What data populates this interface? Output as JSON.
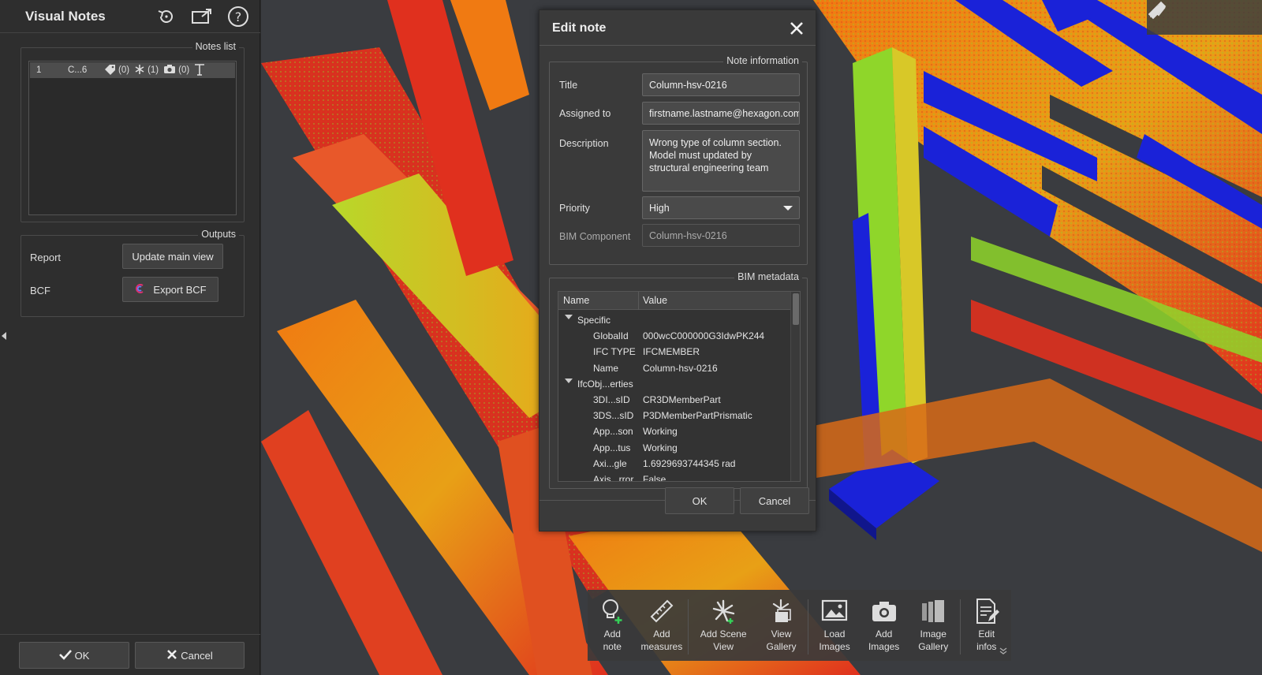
{
  "left_panel": {
    "title": "Visual Notes",
    "notes_list": {
      "group_title": "Notes list",
      "items": [
        {
          "index": "1",
          "name": "C...6",
          "tags": "(0)",
          "views": "(1)",
          "images": "(0)"
        }
      ]
    },
    "outputs": {
      "group_title": "Outputs",
      "report_label": "Report",
      "update_main_view": "Update main view",
      "bcf_label": "BCF",
      "export_bcf": "Export BCF"
    },
    "footer": {
      "ok": "OK",
      "cancel": "Cancel"
    }
  },
  "dialog": {
    "title": "Edit note",
    "note_info": {
      "group_title": "Note information",
      "title_label": "Title",
      "title_value": "Column-hsv-0216",
      "assigned_label": "Assigned to",
      "assigned_value": "firstname.lastname@hexagon.com",
      "description_label": "Description",
      "description_value": "Wrong type of column section. Model must updated by structural engineering team",
      "priority_label": "Priority",
      "priority_value": "High",
      "bim_label": "BIM Component",
      "bim_value": "Column-hsv-0216"
    },
    "bim_metadata": {
      "group_title": "BIM metadata",
      "col_name": "Name",
      "col_value": "Value",
      "rows": [
        {
          "name": "Specific",
          "value": "",
          "group": true
        },
        {
          "name": "GlobalId",
          "value": "000wcC000000G3IdwPK244"
        },
        {
          "name": "IFC TYPE",
          "value": "IFCMEMBER"
        },
        {
          "name": "Name",
          "value": "Column-hsv-0216"
        },
        {
          "name": "IfcObj...erties",
          "value": "",
          "group": true
        },
        {
          "name": "3DI...sID",
          "value": "CR3DMemberPart"
        },
        {
          "name": "3DS...sID",
          "value": "P3DMemberPartPrismatic"
        },
        {
          "name": "App...son",
          "value": "Working"
        },
        {
          "name": "App...tus",
          "value": "Working"
        },
        {
          "name": "Axi...gle",
          "value": "1.6929693744345 rad"
        },
        {
          "name": "Axis...rror",
          "value": "False"
        }
      ]
    },
    "ok": "OK",
    "cancel": "Cancel"
  },
  "toolbar": [
    {
      "label": "Add\nnote",
      "icon": "add-note-icon"
    },
    {
      "label": "Add\nmeasures",
      "icon": "ruler-icon"
    },
    {
      "label": "Add Scene\nView",
      "icon": "scene-view-icon"
    },
    {
      "label": "View\nGallery",
      "icon": "view-gallery-icon"
    },
    {
      "label": "Load\nImages",
      "icon": "image-icon"
    },
    {
      "label": "Add\nImages",
      "icon": "camera-icon"
    },
    {
      "label": "Image\nGallery",
      "icon": "image-gallery-icon"
    },
    {
      "label": "Edit\ninfos",
      "icon": "edit-infos-icon"
    }
  ],
  "colors": {
    "panel_bg": "#2e2e2e",
    "dialog_bg": "#3a3a3a",
    "viewport_bg": "#3a3c40",
    "cloud_red": "#e0301e",
    "cloud_orange": "#f07a12",
    "cloud_green": "#8fd62a",
    "bim_blue": "#1a22d8"
  }
}
